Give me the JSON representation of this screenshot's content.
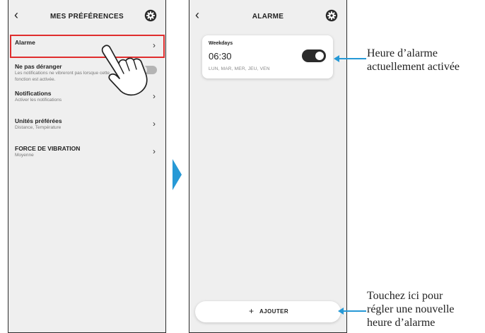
{
  "left_screen": {
    "title": "MES PRÉFÉRENCES",
    "back_icon": "chevron-left-icon",
    "settings_icon": "gear-icon",
    "items": [
      {
        "label": "Alarme",
        "sub": ""
      },
      {
        "label": "Ne pas déranger",
        "sub": "Les notifications ne vibreront pas lorsque cette fonction est activée."
      },
      {
        "label": "Notifications",
        "sub": "Activer les notifications"
      },
      {
        "label": "Unités préférées",
        "sub": "Distance, Température"
      },
      {
        "label": "FORCE DE VIBRATION",
        "sub": "Moyenne"
      }
    ],
    "chevron": "›",
    "hand_icon": "pointing-hand-icon"
  },
  "right_screen": {
    "title": "ALARME",
    "back_icon": "chevron-left-icon",
    "settings_icon": "gear-icon",
    "alarm": {
      "name": "Weekdays",
      "time": "06:30",
      "days": "LUN, MAR, MER, JEU, VEN",
      "enabled": true
    },
    "add_plus": "+",
    "add_label": "AJOUTER"
  },
  "callouts": {
    "alarm_line1": "Heure d’alarme",
    "alarm_line2": "actuellement activée",
    "add_line1": "Touchez ici pour",
    "add_line2": "régler une nouvelle",
    "add_line3": "heure d’alarme"
  },
  "colors": {
    "accent": "#2699d6",
    "highlight": "#e02d2d",
    "screen_bg": "#efefef"
  }
}
